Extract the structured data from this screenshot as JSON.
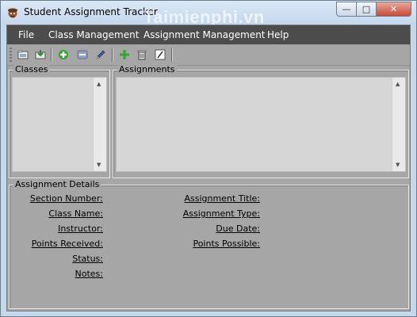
{
  "window": {
    "title": "Student Assignment Tracker",
    "watermark": "Taimienphi.vn",
    "controls": {
      "minimize": "—",
      "maximize": "□",
      "close": "✕"
    }
  },
  "menu": [
    {
      "label": "File"
    },
    {
      "label": "Class Management"
    },
    {
      "label": "Assignment Management"
    },
    {
      "label": "Help"
    }
  ],
  "toolbar": {
    "icons": [
      "open-folder-icon",
      "import-icon",
      "add-class-icon",
      "remove-class-icon",
      "edit-class-icon",
      "add-assignment-icon",
      "delete-assignment-icon",
      "edit-assignment-icon"
    ]
  },
  "classes": {
    "label": "Classes"
  },
  "assignments": {
    "label": "Assignments"
  },
  "details": {
    "label": "Assignment Details",
    "left_fields": [
      "Section Number:",
      "Class Name:",
      "Instructor:",
      "Points Received:",
      "Status:",
      "Notes:"
    ],
    "right_fields": [
      "Assignment Title:",
      "Assignment Type:",
      "Due Date:",
      "Points Possible:"
    ]
  },
  "colors": {
    "menubar": "#4c4c4c",
    "panel": "#a6a6a6",
    "listbox": "#d6d6d6",
    "titlebar": "#c6d9ec"
  }
}
